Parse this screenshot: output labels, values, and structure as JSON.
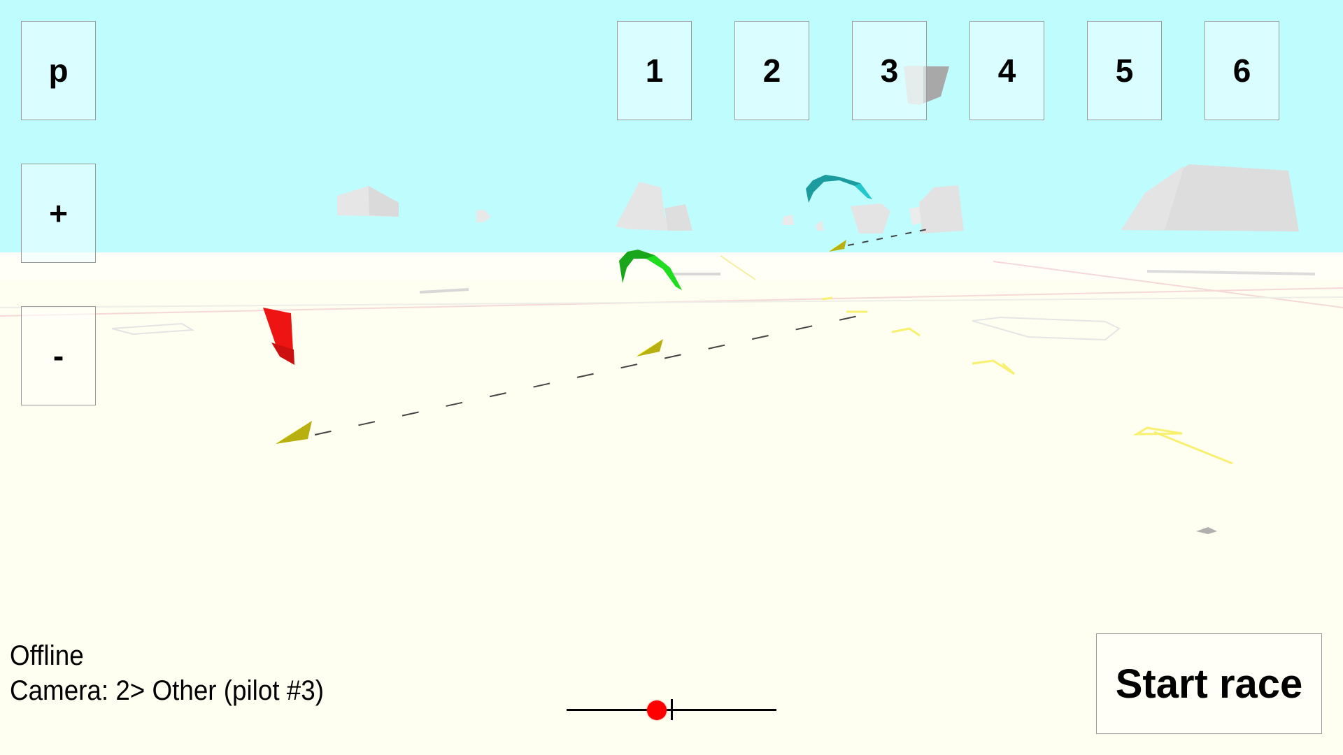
{
  "scene": {
    "sky_color": "#bffcfe",
    "ground_color": "#fefff0",
    "objects": [
      {
        "kind": "kite",
        "color": "#e81010",
        "label": "red-kite"
      },
      {
        "kind": "kite",
        "color": "#1aa81a",
        "label": "green-kite"
      },
      {
        "kind": "kite",
        "color": "#1a9ea2",
        "label": "teal-kite"
      },
      {
        "kind": "marker",
        "color": "#e6e020",
        "label": "yellow-buoy"
      },
      {
        "kind": "building",
        "color": "#e0e0e0",
        "label": "distant-block"
      }
    ]
  },
  "left_controls": {
    "pause_label": "p",
    "zoom_in_label": "+",
    "zoom_out_label": "-"
  },
  "camera_buttons": [
    "1",
    "2",
    "3",
    "4",
    "5",
    "6"
  ],
  "status": {
    "connection": "Offline",
    "camera": "Camera: 2> Other (pilot #3)"
  },
  "timeline_slider": {
    "value_fraction": 0.43,
    "marker_fraction": 0.5,
    "knob_color": "#ff0000"
  },
  "start_race_label": "Start race"
}
